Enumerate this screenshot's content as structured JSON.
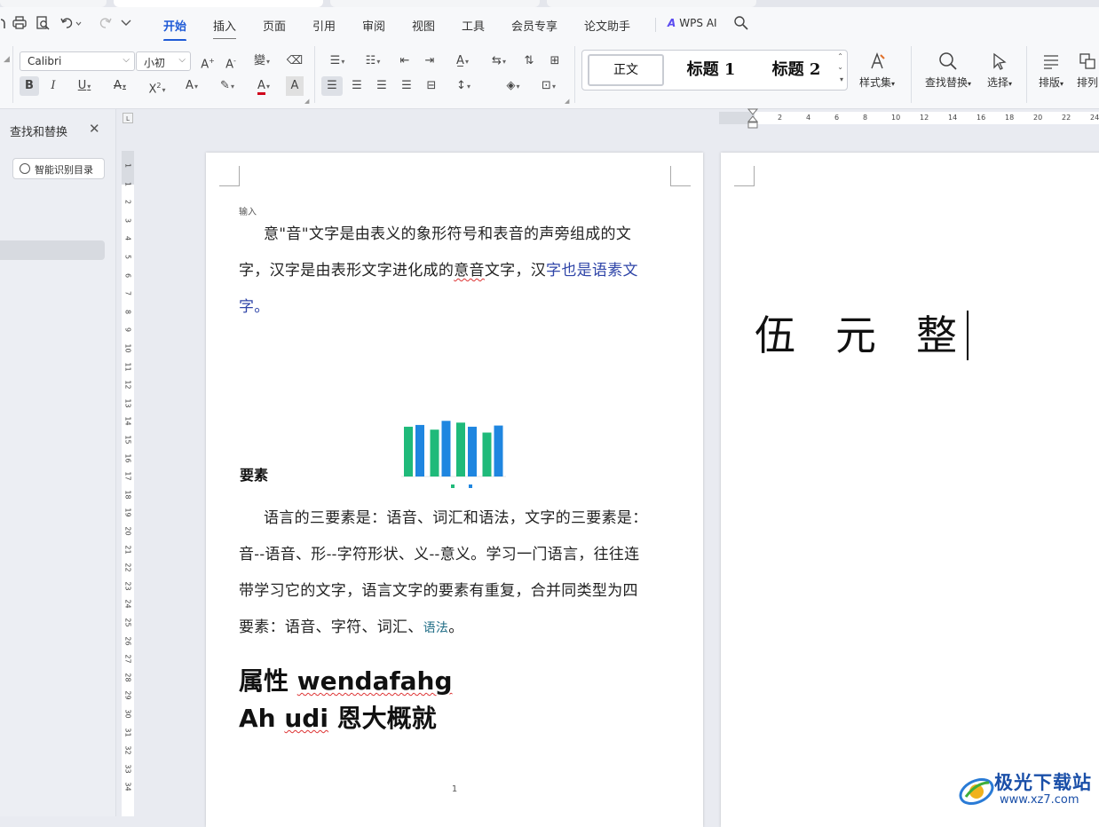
{
  "menu": {
    "items": [
      "开始",
      "插入",
      "页面",
      "引用",
      "审阅",
      "视图",
      "工具",
      "会员专享",
      "论文助手"
    ],
    "active_index": 0,
    "wps_ai": "WPS AI"
  },
  "toolbar": {
    "font_name": "Calibri",
    "font_size": "小初",
    "styles": {
      "normal": "正文",
      "heading1": "标题 1",
      "heading2": "标题 2"
    },
    "style_set_label": "样式集",
    "find_replace_label": "查找替换",
    "select_label": "选择",
    "layout_label": "排版",
    "arrange_label": "排列"
  },
  "nav_pane": {
    "title": "查找和替换",
    "smart_toc_button": "智能识别目录"
  },
  "rulers": {
    "vertical": [
      "1",
      "1",
      "2",
      "3",
      "4",
      "5",
      "6",
      "7",
      "8",
      "9",
      "10",
      "11",
      "12",
      "13",
      "14",
      "15",
      "16",
      "17",
      "18",
      "19",
      "20",
      "21",
      "22",
      "23",
      "24",
      "25",
      "26",
      "27",
      "28",
      "29",
      "30",
      "31",
      "32",
      "33",
      "34"
    ],
    "horizontal": [
      "2",
      "4",
      "6",
      "8",
      "10",
      "12",
      "14",
      "16",
      "18",
      "20",
      "22",
      "24"
    ]
  },
  "page1": {
    "input_label": "输入",
    "para1": {
      "line1": "意\"音\"文字是由表义的象形符号和表音的声旁组成的文",
      "line2_a": "字，汉字是由表形文字进化成的",
      "line2_squig": "意音",
      "line2_b": "文字，汉",
      "line2_blue": "字也是语素文",
      "line3_blue": "字。"
    },
    "heading_yaosu": "要素",
    "para2": {
      "line1": "语言的三要素是：语音、词汇和语法，文字的三要素是：",
      "line2": "音--语音、形--字符形状、义--意义。学习一门语言，往往连",
      "line3": "带学习它的文字，语言文字的要素有重复，合并同类型为四",
      "line4_a": "要素：语音、字符、词汇、",
      "line4_teal": "语法",
      "line4_end": "。"
    },
    "heading_line1_a": "属性 ",
    "heading_line1_squig": "wendafahg",
    "heading_line2_a": "Ah ",
    "heading_line2_squig": "udi",
    "heading_line2_b": " 恩大概就",
    "page_number": "1"
  },
  "page2": {
    "chars": [
      "伍",
      "元",
      "整"
    ]
  },
  "chart_data": {
    "type": "bar",
    "categories": [
      "",
      "",
      "",
      ""
    ],
    "series": [
      {
        "name": "",
        "values": [
          85,
          80,
          92,
          75
        ]
      },
      {
        "name": "",
        "values": [
          88,
          95,
          85,
          87
        ]
      }
    ],
    "ylim": [
      0,
      100
    ],
    "colors": [
      "#1fba7a",
      "#1f86e0"
    ],
    "legend_position": "bottom"
  },
  "watermark": {
    "text": "极光下载站",
    "url": "www.xz7.com"
  }
}
